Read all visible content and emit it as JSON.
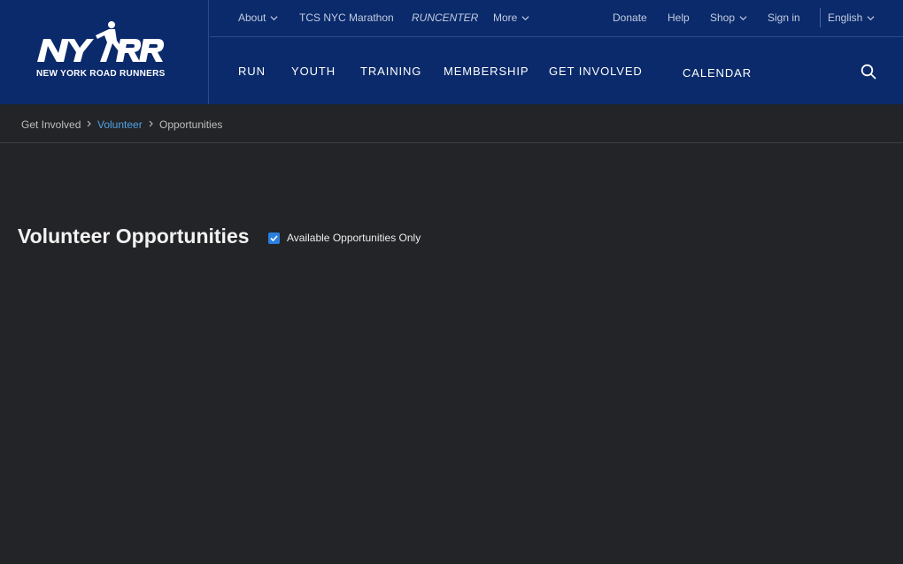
{
  "brand": {
    "logo_mark": "NYRR",
    "name": "NEW YORK ROAD RUNNERS"
  },
  "utility_nav": {
    "about": "About",
    "marathon": "TCS NYC Marathon",
    "runcenter": "RUNCENTER",
    "more": "More",
    "donate": "Donate",
    "help": "Help",
    "shop": "Shop",
    "sign_in": "Sign in",
    "language": "English"
  },
  "main_nav": {
    "run": "RUN",
    "youth": "YOUTH",
    "training": "TRAINING",
    "membership": "MEMBERSHIP",
    "get_involved": "GET INVOLVED",
    "calendar": "CALENDAR"
  },
  "icons": {
    "search": "search-icon",
    "chevron": "chevron-down-icon",
    "breadcrumb_separator": "chevron-right-icon"
  },
  "breadcrumb": {
    "items": [
      "Get Involved",
      "Volunteer",
      "Opportunities"
    ]
  },
  "page": {
    "title": "Volunteer Opportunities",
    "filter_label": "Available Opportunities Only",
    "filter_checked": true
  },
  "colors": {
    "header_bg": "#0a2a6b",
    "page_bg": "#232427",
    "link": "#4fa3e8",
    "checkbox": "#2a7fe0"
  }
}
